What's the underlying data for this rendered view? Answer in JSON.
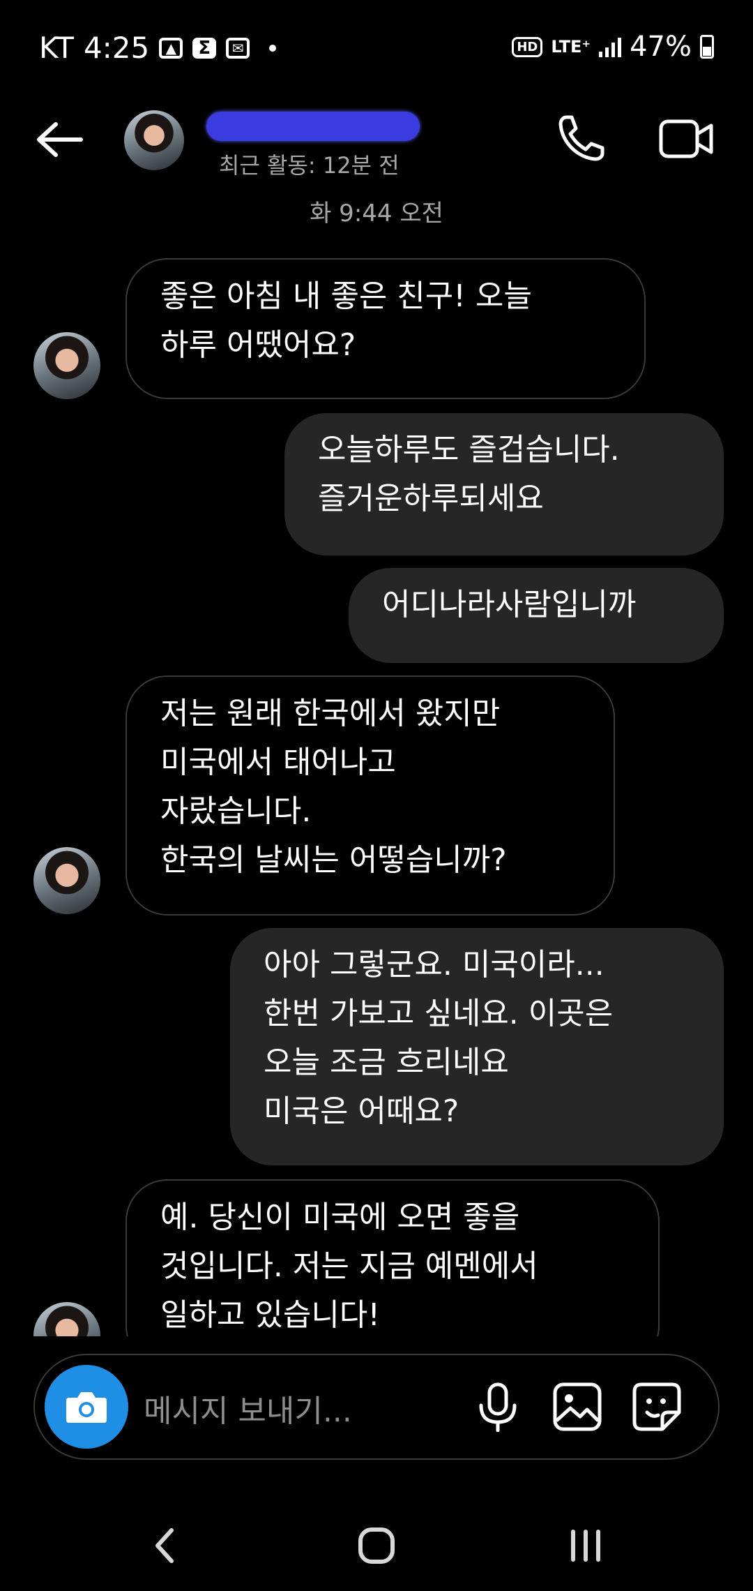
{
  "status_bar": {
    "carrier": "KT",
    "time": "4:25",
    "network": "LTE⁺",
    "hd": "HD",
    "battery": "47%"
  },
  "header": {
    "activity": "최근 활동: 12분 전"
  },
  "timestamp": "화 9:44 오전",
  "messages": [
    {
      "side": "in",
      "text": "좋은 아침 내 좋은 친구!  오늘\n하루 어땠어요?"
    },
    {
      "side": "out",
      "text": "오늘하루도 즐겁습니다.\n즐거운하루되세요"
    },
    {
      "side": "out",
      "text": "어디나라사람입니까"
    },
    {
      "side": "in",
      "text": "저는 원래 한국에서 왔지만\n미국에서 태어나고\n자랐습니다.\n 한국의 날씨는 어떻습니까?"
    },
    {
      "side": "out",
      "text": "아아 그렇군요. 미국이라...\n한번 가보고 싶네요. 이곳은\n오늘 조금 흐리네요\n미국은 어때요?"
    },
    {
      "side": "in",
      "text": "예.  당신이 미국에 오면 좋을\n것입니다.  저는 지금 예멘에서\n일하고 있습니다!"
    }
  ],
  "composer": {
    "placeholder": "메시지 보내기..."
  },
  "icons": {
    "back": "arrow-left-icon",
    "call": "phone-icon",
    "video": "video-camera-icon",
    "camera": "camera-icon",
    "mic": "microphone-icon",
    "gallery": "image-icon",
    "sticker": "sticker-icon",
    "nav_back": "chevron-left-icon",
    "nav_home": "home-icon",
    "nav_recents": "recents-icon"
  },
  "colors": {
    "background": "#000000",
    "outgoing_bubble": "#262626",
    "camera_button": "#1f8fe6"
  }
}
